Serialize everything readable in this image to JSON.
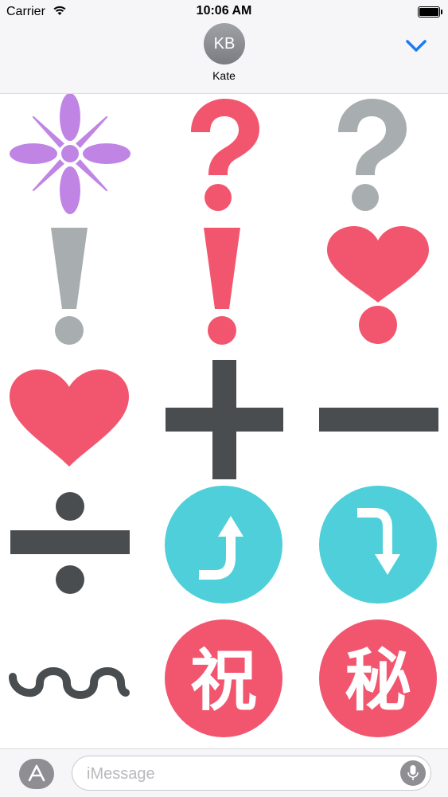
{
  "status_bar": {
    "carrier": "Carrier",
    "time": "10:06 AM"
  },
  "header": {
    "avatar_initials": "KB",
    "contact_name": "Kate",
    "accent_color": "#1a7cf5"
  },
  "stickers": [
    {
      "name": "sparkle-sticker",
      "glyph": "✳",
      "color": "#c085e4"
    },
    {
      "name": "red-question-sticker",
      "glyph": "?",
      "color": "#f2566f"
    },
    {
      "name": "gray-question-sticker",
      "glyph": "?",
      "color": "#a8adb0"
    },
    {
      "name": "gray-exclamation-sticker",
      "glyph": "!",
      "color": "#a8adb0"
    },
    {
      "name": "red-exclamation-sticker",
      "glyph": "!",
      "color": "#f2566f"
    },
    {
      "name": "heart-exclamation-sticker",
      "glyph": "❣",
      "color": "#f2566f"
    },
    {
      "name": "heart-sticker",
      "glyph": "♥",
      "color": "#f2566f"
    },
    {
      "name": "plus-sticker",
      "glyph": "+",
      "color": "#4a4d50"
    },
    {
      "name": "minus-sticker",
      "glyph": "−",
      "color": "#4a4d50"
    },
    {
      "name": "divide-sticker",
      "glyph": "÷",
      "color": "#4a4d50"
    },
    {
      "name": "arrow-curve-up-sticker",
      "glyph": "⤴",
      "color": "#4ecfd9"
    },
    {
      "name": "arrow-curve-down-sticker",
      "glyph": "⤵",
      "color": "#4ecfd9"
    },
    {
      "name": "wavy-dash-sticker",
      "glyph": "〰",
      "color": "#4a4d50"
    },
    {
      "name": "celebration-sticker",
      "glyph": "祝",
      "color": "#f2566f"
    },
    {
      "name": "secret-sticker",
      "glyph": "秘",
      "color": "#f2566f"
    }
  ],
  "input_bar": {
    "placeholder": "iMessage",
    "value": ""
  }
}
